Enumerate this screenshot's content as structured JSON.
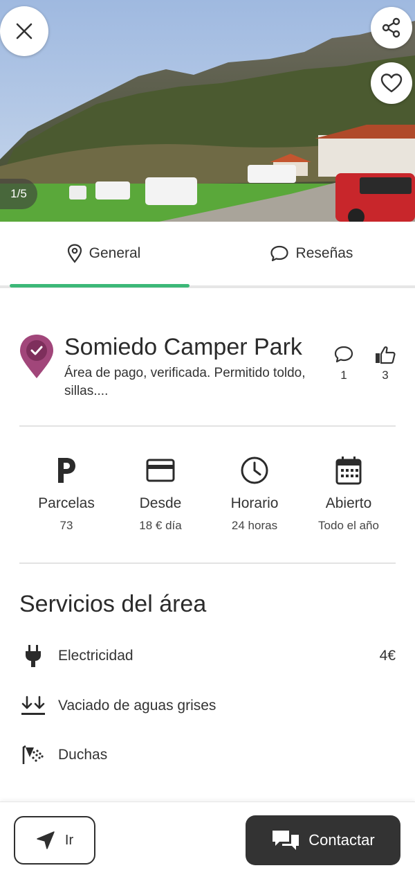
{
  "hero": {
    "photo_counter": "1/5",
    "close_icon": "close-icon",
    "share_icon": "share-icon",
    "favorite_icon": "heart-icon"
  },
  "tabs": [
    {
      "label": "General",
      "icon": "location-pin-icon",
      "active": true
    },
    {
      "label": "Reseñas",
      "icon": "chat-bubble-icon",
      "active": false
    }
  ],
  "place": {
    "name": "Somiedo Camper Park",
    "description": "Área de pago, verificada. Permitido toldo, sillas....",
    "comments_count": "1",
    "likes_count": "3"
  },
  "info": [
    {
      "icon": "parking-icon",
      "label": "Parcelas",
      "value": "73"
    },
    {
      "icon": "credit-card-icon",
      "label": "Desde",
      "value": "18 € día"
    },
    {
      "icon": "clock-icon",
      "label": "Horario",
      "value": "24 horas"
    },
    {
      "icon": "calendar-icon",
      "label": "Abierto",
      "value": "Todo el año"
    }
  ],
  "services": {
    "title": "Servicios del área",
    "items": [
      {
        "icon": "plug-icon",
        "label": "Electricidad",
        "price": "4€"
      },
      {
        "icon": "drain-icon",
        "label": "Vaciado de aguas grises",
        "price": ""
      },
      {
        "icon": "shower-icon",
        "label": "Duchas",
        "price": ""
      }
    ]
  },
  "actions": {
    "go_label": "Ir",
    "contact_label": "Contactar"
  },
  "colors": {
    "accent": "#3cb878",
    "pin": "#a1467a",
    "dark_button": "#333333"
  }
}
